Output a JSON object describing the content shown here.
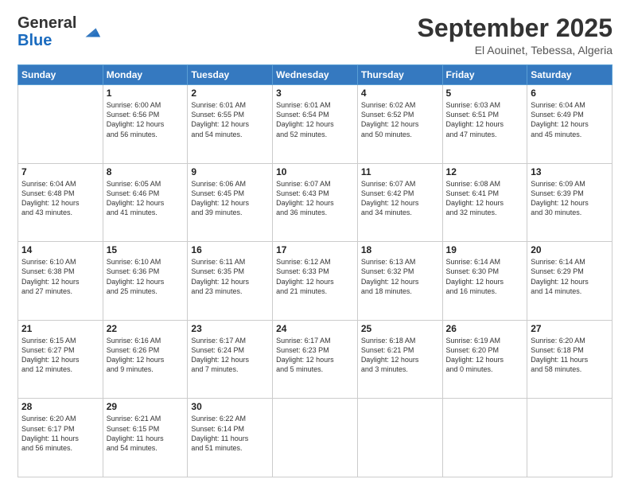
{
  "header": {
    "logo_line1": "General",
    "logo_line2": "Blue",
    "month_title": "September 2025",
    "location": "El Aouinet, Tebessa, Algeria"
  },
  "weekdays": [
    "Sunday",
    "Monday",
    "Tuesday",
    "Wednesday",
    "Thursday",
    "Friday",
    "Saturday"
  ],
  "weeks": [
    [
      {
        "day": "",
        "text": ""
      },
      {
        "day": "1",
        "text": "Sunrise: 6:00 AM\nSunset: 6:56 PM\nDaylight: 12 hours\nand 56 minutes."
      },
      {
        "day": "2",
        "text": "Sunrise: 6:01 AM\nSunset: 6:55 PM\nDaylight: 12 hours\nand 54 minutes."
      },
      {
        "day": "3",
        "text": "Sunrise: 6:01 AM\nSunset: 6:54 PM\nDaylight: 12 hours\nand 52 minutes."
      },
      {
        "day": "4",
        "text": "Sunrise: 6:02 AM\nSunset: 6:52 PM\nDaylight: 12 hours\nand 50 minutes."
      },
      {
        "day": "5",
        "text": "Sunrise: 6:03 AM\nSunset: 6:51 PM\nDaylight: 12 hours\nand 47 minutes."
      },
      {
        "day": "6",
        "text": "Sunrise: 6:04 AM\nSunset: 6:49 PM\nDaylight: 12 hours\nand 45 minutes."
      }
    ],
    [
      {
        "day": "7",
        "text": "Sunrise: 6:04 AM\nSunset: 6:48 PM\nDaylight: 12 hours\nand 43 minutes."
      },
      {
        "day": "8",
        "text": "Sunrise: 6:05 AM\nSunset: 6:46 PM\nDaylight: 12 hours\nand 41 minutes."
      },
      {
        "day": "9",
        "text": "Sunrise: 6:06 AM\nSunset: 6:45 PM\nDaylight: 12 hours\nand 39 minutes."
      },
      {
        "day": "10",
        "text": "Sunrise: 6:07 AM\nSunset: 6:43 PM\nDaylight: 12 hours\nand 36 minutes."
      },
      {
        "day": "11",
        "text": "Sunrise: 6:07 AM\nSunset: 6:42 PM\nDaylight: 12 hours\nand 34 minutes."
      },
      {
        "day": "12",
        "text": "Sunrise: 6:08 AM\nSunset: 6:41 PM\nDaylight: 12 hours\nand 32 minutes."
      },
      {
        "day": "13",
        "text": "Sunrise: 6:09 AM\nSunset: 6:39 PM\nDaylight: 12 hours\nand 30 minutes."
      }
    ],
    [
      {
        "day": "14",
        "text": "Sunrise: 6:10 AM\nSunset: 6:38 PM\nDaylight: 12 hours\nand 27 minutes."
      },
      {
        "day": "15",
        "text": "Sunrise: 6:10 AM\nSunset: 6:36 PM\nDaylight: 12 hours\nand 25 minutes."
      },
      {
        "day": "16",
        "text": "Sunrise: 6:11 AM\nSunset: 6:35 PM\nDaylight: 12 hours\nand 23 minutes."
      },
      {
        "day": "17",
        "text": "Sunrise: 6:12 AM\nSunset: 6:33 PM\nDaylight: 12 hours\nand 21 minutes."
      },
      {
        "day": "18",
        "text": "Sunrise: 6:13 AM\nSunset: 6:32 PM\nDaylight: 12 hours\nand 18 minutes."
      },
      {
        "day": "19",
        "text": "Sunrise: 6:14 AM\nSunset: 6:30 PM\nDaylight: 12 hours\nand 16 minutes."
      },
      {
        "day": "20",
        "text": "Sunrise: 6:14 AM\nSunset: 6:29 PM\nDaylight: 12 hours\nand 14 minutes."
      }
    ],
    [
      {
        "day": "21",
        "text": "Sunrise: 6:15 AM\nSunset: 6:27 PM\nDaylight: 12 hours\nand 12 minutes."
      },
      {
        "day": "22",
        "text": "Sunrise: 6:16 AM\nSunset: 6:26 PM\nDaylight: 12 hours\nand 9 minutes."
      },
      {
        "day": "23",
        "text": "Sunrise: 6:17 AM\nSunset: 6:24 PM\nDaylight: 12 hours\nand 7 minutes."
      },
      {
        "day": "24",
        "text": "Sunrise: 6:17 AM\nSunset: 6:23 PM\nDaylight: 12 hours\nand 5 minutes."
      },
      {
        "day": "25",
        "text": "Sunrise: 6:18 AM\nSunset: 6:21 PM\nDaylight: 12 hours\nand 3 minutes."
      },
      {
        "day": "26",
        "text": "Sunrise: 6:19 AM\nSunset: 6:20 PM\nDaylight: 12 hours\nand 0 minutes."
      },
      {
        "day": "27",
        "text": "Sunrise: 6:20 AM\nSunset: 6:18 PM\nDaylight: 11 hours\nand 58 minutes."
      }
    ],
    [
      {
        "day": "28",
        "text": "Sunrise: 6:20 AM\nSunset: 6:17 PM\nDaylight: 11 hours\nand 56 minutes."
      },
      {
        "day": "29",
        "text": "Sunrise: 6:21 AM\nSunset: 6:15 PM\nDaylight: 11 hours\nand 54 minutes."
      },
      {
        "day": "30",
        "text": "Sunrise: 6:22 AM\nSunset: 6:14 PM\nDaylight: 11 hours\nand 51 minutes."
      },
      {
        "day": "",
        "text": ""
      },
      {
        "day": "",
        "text": ""
      },
      {
        "day": "",
        "text": ""
      },
      {
        "day": "",
        "text": ""
      }
    ]
  ]
}
